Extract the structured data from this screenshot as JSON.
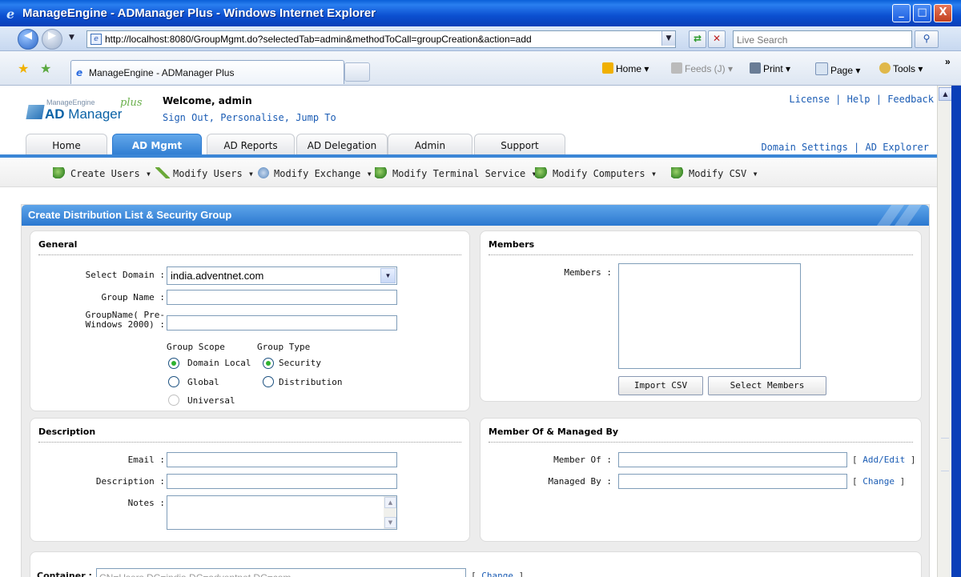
{
  "window": {
    "title": "ManageEngine - ADManager Plus - Windows Internet Explorer",
    "min": "_",
    "max": "□",
    "close": "X"
  },
  "browser": {
    "url": "http://localhost:8080/GroupMgmt.do?selectedTab=admin&methodToCall=groupCreation&action=add",
    "search_placeholder": "Live Search",
    "tab_title": "ManageEngine - ADManager Plus",
    "commands": {
      "home": "Home",
      "feeds": "Feeds (J)",
      "print": "Print",
      "page": "Page",
      "tools": "Tools"
    }
  },
  "app": {
    "logo": {
      "brand": "ManageEngine",
      "ad": "AD",
      "manager": "Manager",
      "plus": "plus"
    },
    "welcome": "Welcome, admin",
    "user_links": [
      "Sign Out",
      "Personalise",
      "Jump To"
    ],
    "top_links": [
      "License",
      "Help",
      "Feedback"
    ],
    "tabs": [
      "Home",
      "AD Mgmt",
      "AD Reports",
      "AD Delegation",
      "Admin",
      "Support"
    ],
    "active_tab": "AD Mgmt",
    "domain_links": [
      "Domain Settings",
      "AD Explorer"
    ],
    "submenu": [
      "Create Users",
      "Modify Users",
      "Modify Exchange",
      "Modify Terminal Service",
      "Modify Computers",
      "Modify CSV"
    ]
  },
  "form": {
    "heading": "Create Distribution List & Security Group",
    "general": {
      "title": "General",
      "domain_label": "Select Domain :",
      "domain_value": "india.adventnet.com",
      "group_name_label": "Group Name :",
      "group_name_pre_label_1": "GroupName( Pre-",
      "group_name_pre_label_2": "Windows 2000) :",
      "scope_title": "Group Scope",
      "type_title": "Group Type",
      "scope_options": [
        "Domain Local",
        "Global",
        "Universal"
      ],
      "selected_scope": "Domain Local",
      "type_options": [
        "Security",
        "Distribution"
      ],
      "selected_type": "Security"
    },
    "members": {
      "title": "Members",
      "members_label": "Members :",
      "import_button": "Import CSV",
      "select_button": "Select Members"
    },
    "description": {
      "title": "Description",
      "email_label": "Email :",
      "description_label": "Description :",
      "notes_label": "Notes :"
    },
    "member_of": {
      "title": "Member Of & Managed By",
      "member_of_label": "Member Of :",
      "managed_by_label": "Managed By :",
      "add_edit_link": "Add/Edit",
      "change_link": "Change"
    },
    "container": {
      "label": "Container :",
      "value": "CN=Users,DC=india,DC=adventnet,DC=com",
      "change_link": "Change"
    }
  }
}
